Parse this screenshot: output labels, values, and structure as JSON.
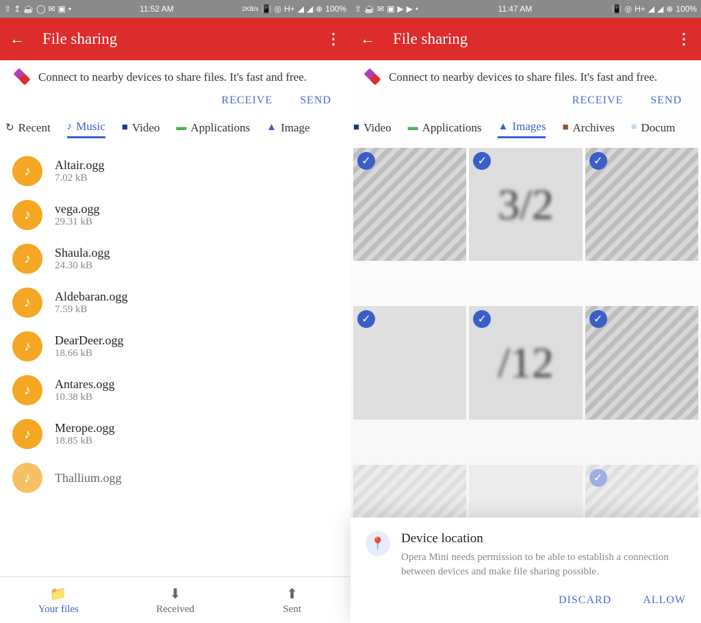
{
  "left": {
    "status": {
      "time": "11:52 AM",
      "net": "2KB/s",
      "battery": "100%",
      "signal": "H+"
    },
    "appbar": {
      "title": "File sharing"
    },
    "banner": {
      "text": "Connect to nearby devices to share files. It's fast and free.",
      "receive": "RECEIVE",
      "send": "SEND"
    },
    "tabs": {
      "recent": "Recent",
      "music": "Music",
      "video": "Video",
      "apps": "Applications",
      "images": "Image"
    },
    "files": [
      {
        "name": "Altair.ogg",
        "size": "7.02 kB"
      },
      {
        "name": "vega.ogg",
        "size": "29.31 kB"
      },
      {
        "name": "Shaula.ogg",
        "size": "24.30 kB"
      },
      {
        "name": "Aldebaran.ogg",
        "size": "7.59 kB"
      },
      {
        "name": "DearDeer.ogg",
        "size": "18.66 kB"
      },
      {
        "name": "Antares.ogg",
        "size": "10.38 kB"
      },
      {
        "name": "Merope.ogg",
        "size": "18.85 kB"
      },
      {
        "name": "Thallium.ogg",
        "size": ""
      }
    ],
    "bottom": {
      "yourfiles": "Your files",
      "received": "Received",
      "sent": "Sent"
    }
  },
  "right": {
    "status": {
      "time": "11:47 AM",
      "battery": "100%",
      "signal": "H+"
    },
    "appbar": {
      "title": "File sharing"
    },
    "banner": {
      "text": "Connect to nearby devices to share files. It's fast and free.",
      "receive": "RECEIVE",
      "send": "SEND"
    },
    "tabs": {
      "video": "Video",
      "apps": "Applications",
      "images": "Images",
      "archives": "Archives",
      "docs": "Docum"
    },
    "images": [
      {
        "selected": true
      },
      {
        "selected": true,
        "label": "3/2"
      },
      {
        "selected": true
      },
      {
        "selected": true
      },
      {
        "selected": true,
        "label": "/12"
      },
      {
        "selected": true
      },
      {
        "selected": false
      },
      {
        "selected": false
      },
      {
        "selected": true
      }
    ],
    "dialog": {
      "title": "Device location",
      "body": "Opera Mini needs permission to be able to establish a connection between devices and make file sharing possible.",
      "discard": "DISCARD",
      "allow": "ALLOW"
    }
  }
}
